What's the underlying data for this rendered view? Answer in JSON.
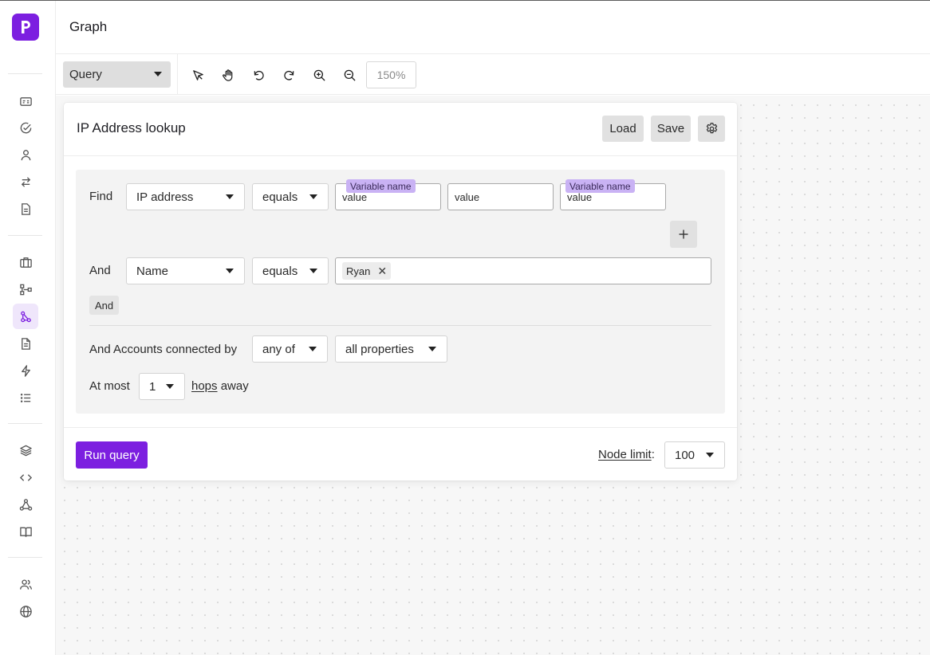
{
  "header": {
    "title": "Graph"
  },
  "toolbar": {
    "mode_select": "Query",
    "zoom": "150%",
    "tools": [
      "select-pointer",
      "pan-hand",
      "undo",
      "redo",
      "zoom-in",
      "zoom-out"
    ]
  },
  "sidebar": {
    "icons": [
      "id-card-icon",
      "check-circle-icon",
      "user-icon",
      "swap-arrows-icon",
      "document-icon",
      "briefcase-icon",
      "hierarchy-icon",
      "graph-icon",
      "file-text-icon",
      "lightning-icon",
      "list-icon",
      "layers-icon",
      "code-icon",
      "network-icon",
      "book-icon",
      "users-icon",
      "globe-icon"
    ],
    "active": "graph-icon"
  },
  "query_panel": {
    "title": "IP Address lookup",
    "load_label": "Load",
    "save_label": "Save",
    "find_row": {
      "label": "Find",
      "field": "IP address",
      "operator": "equals",
      "inputs": [
        {
          "value": "value",
          "tag": "Variable name"
        },
        {
          "value": "value",
          "tag": ""
        },
        {
          "value": "value",
          "tag": "Variable name"
        }
      ]
    },
    "and_row": {
      "label": "And",
      "field": "Name",
      "operator": "equals",
      "chip": "Ryan"
    },
    "and_button": "And",
    "connected": {
      "label": "And Accounts connected by",
      "quantifier": "any of",
      "properties": "all properties"
    },
    "hops": {
      "prefix": "At most",
      "value": "1",
      "hops_word": "hops",
      "suffix": "away"
    },
    "run_label": "Run query",
    "node_limit_label": "Node limit",
    "node_limit_colon": ":",
    "node_limit_value": "100"
  },
  "colors": {
    "brand": "#7c1fe0",
    "active_bg": "#efe6fb",
    "variable_tag": "#c9b2f4"
  }
}
